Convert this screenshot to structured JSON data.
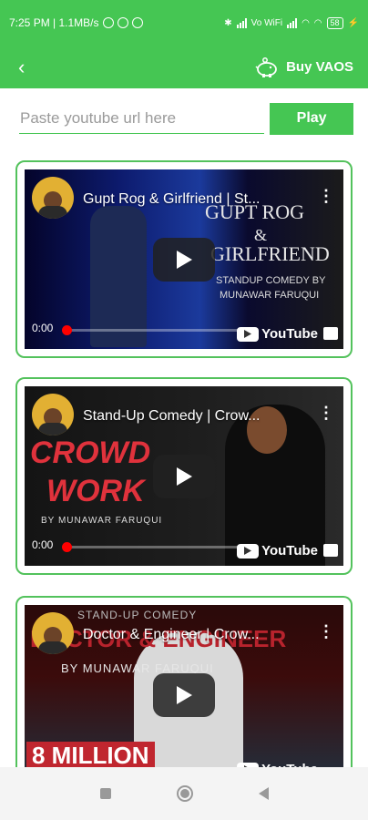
{
  "status_bar": {
    "time_speed": "7:25 PM | 1.1MB/s",
    "volte_label": "Vo WiFi",
    "battery": "58"
  },
  "app_bar": {
    "back_icon": "back-arrow-icon",
    "buy_label": "Buy VAOS",
    "buy_icon": "piggy-bank-icon"
  },
  "search": {
    "placeholder": "Paste youtube url here",
    "play_label": "Play"
  },
  "videos": [
    {
      "title": "Gupt Rog & Girlfriend | St...",
      "time": "0:00",
      "art_line1": "GUPT ROG",
      "art_line2": "&",
      "art_line3": "GIRLFRIEND",
      "art_line4": "STANDUP COMEDY BY",
      "art_line5": "MUNAWAR FARUQUI"
    },
    {
      "title": "Stand-Up Comedy | Crow...",
      "time": "0:00",
      "art_line1": "CROWD",
      "art_line2": "WORK",
      "art_line3": "BY MUNAWAR FARUQUI"
    },
    {
      "title": "Doctor & Engineer | Crow...",
      "time": "",
      "art_line1": "STAND-UP COMEDY",
      "art_line2": "DOCTOR & ENGINEER",
      "art_line3": "BY MUNAWAR FARUQUI",
      "art_line4": "8 MILLION"
    }
  ],
  "youtube_label": "YouTube",
  "colors": {
    "primary": "#45c653",
    "card_border": "#53c25c",
    "progress_red": "#ff0000",
    "crowd_red": "#e0323c"
  },
  "nav": {
    "recents_icon": "square-icon",
    "home_icon": "circle-icon",
    "back_icon": "triangle-back-icon"
  }
}
